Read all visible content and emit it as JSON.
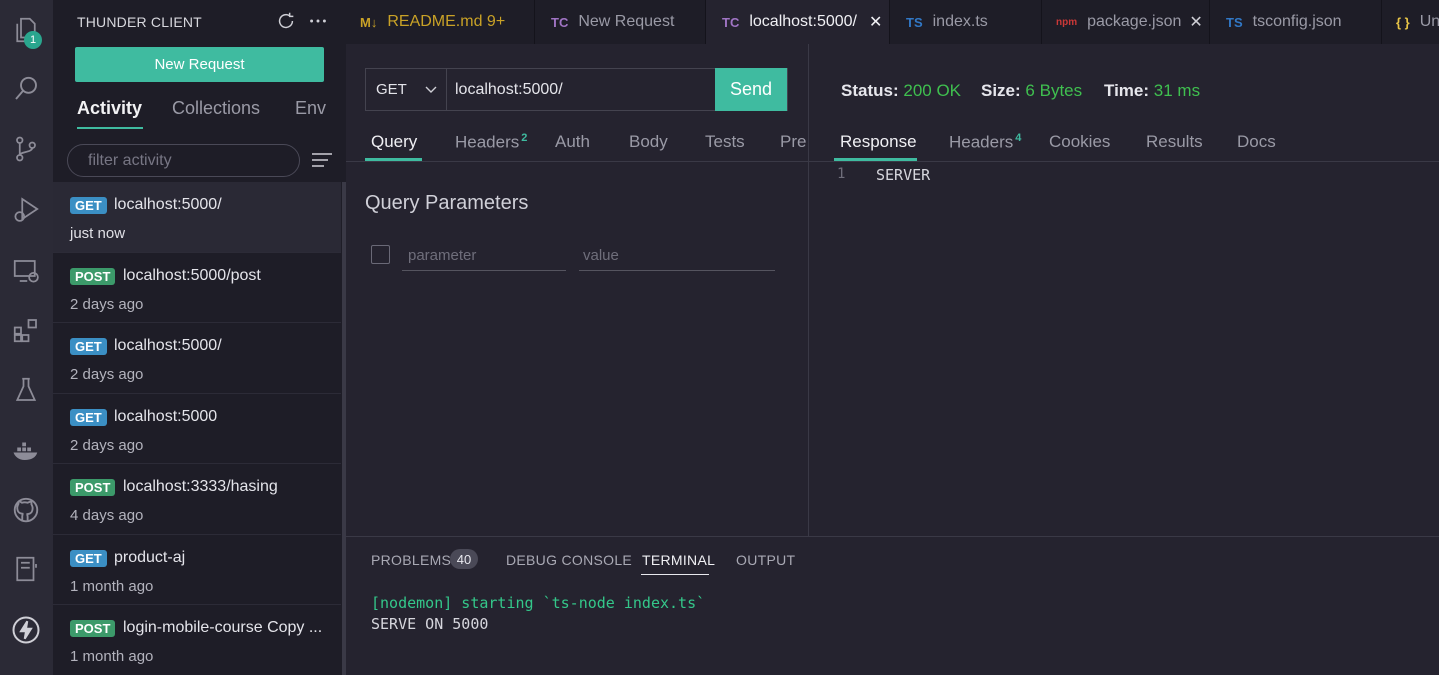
{
  "activity_bar": {
    "explorer_badge": "1"
  },
  "sidebar": {
    "title": "THUNDER CLIENT",
    "new_request_label": "New Request",
    "tabs": [
      "Activity",
      "Collections",
      "Env"
    ],
    "filter_placeholder": "filter activity",
    "items": [
      {
        "method": "GET",
        "url": "localhost:5000/",
        "time": "just now"
      },
      {
        "method": "POST",
        "url": "localhost:5000/post",
        "time": "2 days ago"
      },
      {
        "method": "GET",
        "url": "localhost:5000/",
        "time": "2 days ago"
      },
      {
        "method": "GET",
        "url": "localhost:5000",
        "time": "2 days ago"
      },
      {
        "method": "POST",
        "url": "localhost:3333/hasing",
        "time": "4 days ago"
      },
      {
        "method": "GET",
        "url": "product-aj",
        "time": "1 month ago"
      },
      {
        "method": "POST",
        "url": "login-mobile-course Copy ...",
        "time": "1 month ago"
      }
    ]
  },
  "editor_tabs": [
    {
      "icon": "M↓",
      "label": "README.md 9+",
      "color": "#c9a227"
    },
    {
      "icon": "TC",
      "label": "New Request",
      "color": "#a074c4"
    },
    {
      "icon": "TC",
      "label": "localhost:5000/",
      "color": "#a074c4"
    },
    {
      "icon": "TS",
      "label": "index.ts",
      "color": "#3178c6"
    },
    {
      "icon": "npm",
      "label": "package.json",
      "color": "#cb3837"
    },
    {
      "icon": "TS",
      "label": "tsconfig.json",
      "color": "#3178c6"
    },
    {
      "icon": "{ }",
      "label": "Un",
      "color": "#e8c547"
    }
  ],
  "request": {
    "method": "GET",
    "url": "localhost:5000/",
    "send_label": "Send",
    "tabs": [
      "Query",
      "Headers",
      "Auth",
      "Body",
      "Tests",
      "Pre"
    ],
    "headers_count": "2",
    "query_title": "Query Parameters",
    "param_placeholder": "parameter",
    "value_placeholder": "value"
  },
  "response": {
    "status_label": "Status:",
    "status_value": "200 OK",
    "size_label": "Size:",
    "size_value": "6 Bytes",
    "time_label": "Time:",
    "time_value": "31 ms",
    "tabs": [
      "Response",
      "Headers",
      "Cookies",
      "Results",
      "Docs"
    ],
    "headers_count": "4",
    "line_number": "1",
    "body": "SERVER"
  },
  "panel": {
    "tabs": [
      "PROBLEMS",
      "DEBUG CONSOLE",
      "TERMINAL",
      "OUTPUT"
    ],
    "problems_count": "40",
    "terminal_lines": [
      "[nodemon] starting `ts-node index.ts`",
      "SERVE ON 5000"
    ]
  },
  "colors": {
    "accent": "#3fbba0",
    "status_ok": "#3fbf4f",
    "get_badge": "#3b8fc4",
    "post_badge": "#3c9a6a"
  }
}
